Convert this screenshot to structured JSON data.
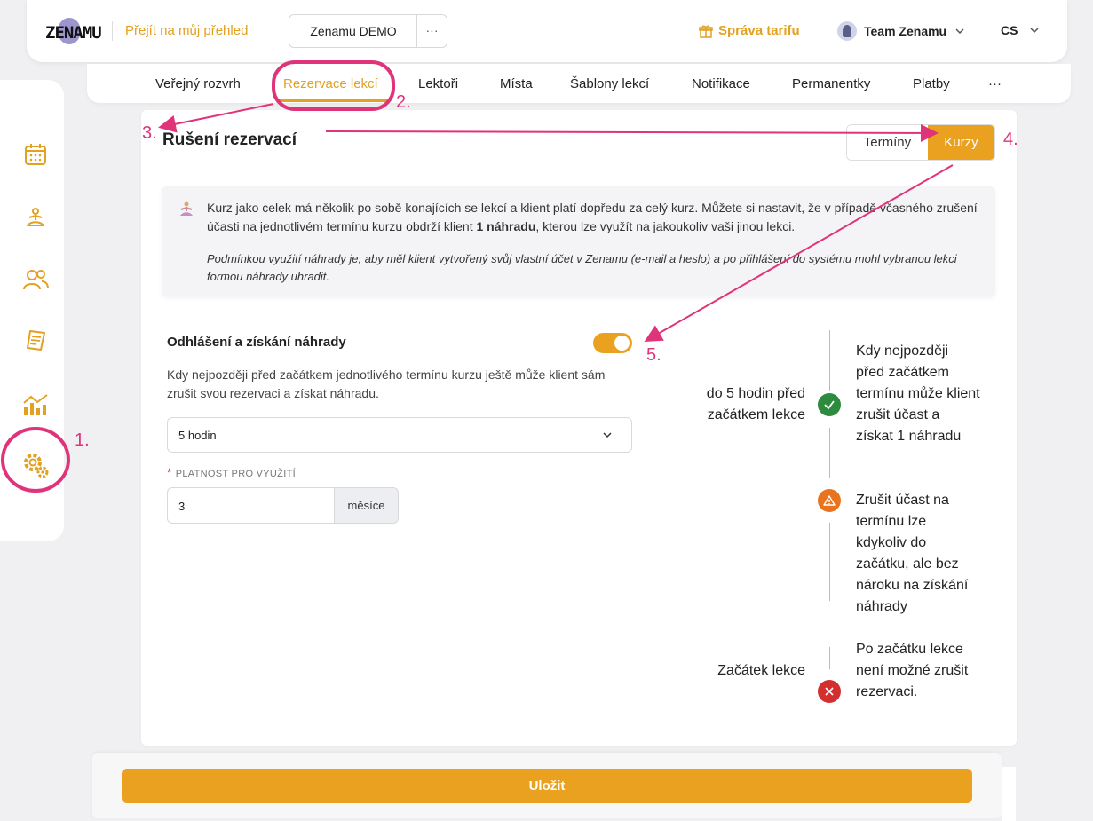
{
  "header": {
    "logo_text": "ZENAMU",
    "dashboard_link": "Přejít na můj přehled",
    "studio_name": "Zenamu DEMO",
    "more_label": "···",
    "tarif_label": "Správa tarifu",
    "team_label": "Team Zenamu",
    "language": "CS"
  },
  "tabs": [
    {
      "label": "Veřejný rozvrh"
    },
    {
      "label": "Rezervace lekcí"
    },
    {
      "label": "Lektoři"
    },
    {
      "label": "Místa"
    },
    {
      "label": "Šablony lekcí"
    },
    {
      "label": "Notifikace"
    },
    {
      "label": "Permanentky"
    },
    {
      "label": "Platby"
    },
    {
      "label": "···"
    }
  ],
  "sidebar": {
    "items": [
      "calendar-icon",
      "meditation-icon",
      "users-icon",
      "receipt-icon",
      "analytics-icon",
      "settings-icon"
    ]
  },
  "card": {
    "title": "Rušení rezervací",
    "segment": {
      "terms": "Termíny",
      "courses": "Kurzy"
    },
    "info": {
      "p1_a": "Kurz jako celek má několik po sobě konajících se lekcí a klient platí dopředu za celý kurz. Můžete si nastavit, že v případě včasného zrušení účasti na jednotlivém termínu kurzu obdrží klient ",
      "p1_bold": "1 náhradu",
      "p1_b": ", kterou lze využít na jakoukoliv vaši jinou lekci.",
      "p2": "Podmínkou využití náhrady je, aby měl klient vytvořený svůj vlastní účet v Zenamu (e-mail a heslo) a po přihlášení do systému mohl vybranou lekci formou náhrady uhradit."
    },
    "section": {
      "title": "Odhlášení a získání náhrady",
      "toggle_on": true,
      "description": "Kdy nejpozději před začátkem jednotlivého termínu kurzu ještě může klient sám zrušit svou rezervaci a získat náhradu.",
      "select_value": "5 hodin",
      "validity_label": "PLATNOST PRO VYUŽITÍ",
      "validity_value": "3",
      "validity_unit": "měsíce"
    },
    "timeline": {
      "left_1": "do 5 hodin před začátkem lekce",
      "right_1": "Kdy nejpozději před začátkem termínu může klient zrušit účast a získat 1 náhradu",
      "right_2": "Zrušit účast na termínu lze kdykoliv do začátku, ale bez nároku na získání náhrady",
      "left_3": "Začátek lekce",
      "right_3": "Po začátku lekce není možné zrušit rezervaci.",
      "colors": {
        "ok": "#2e8b3e",
        "warn": "#e9741f",
        "stop": "#d32f2f"
      }
    }
  },
  "save_label": "Uložit",
  "annotations": [
    "1.",
    "2.",
    "3.",
    "4.",
    "5."
  ],
  "colors": {
    "accent": "#e9a11f",
    "annotation": "#e0347a"
  }
}
